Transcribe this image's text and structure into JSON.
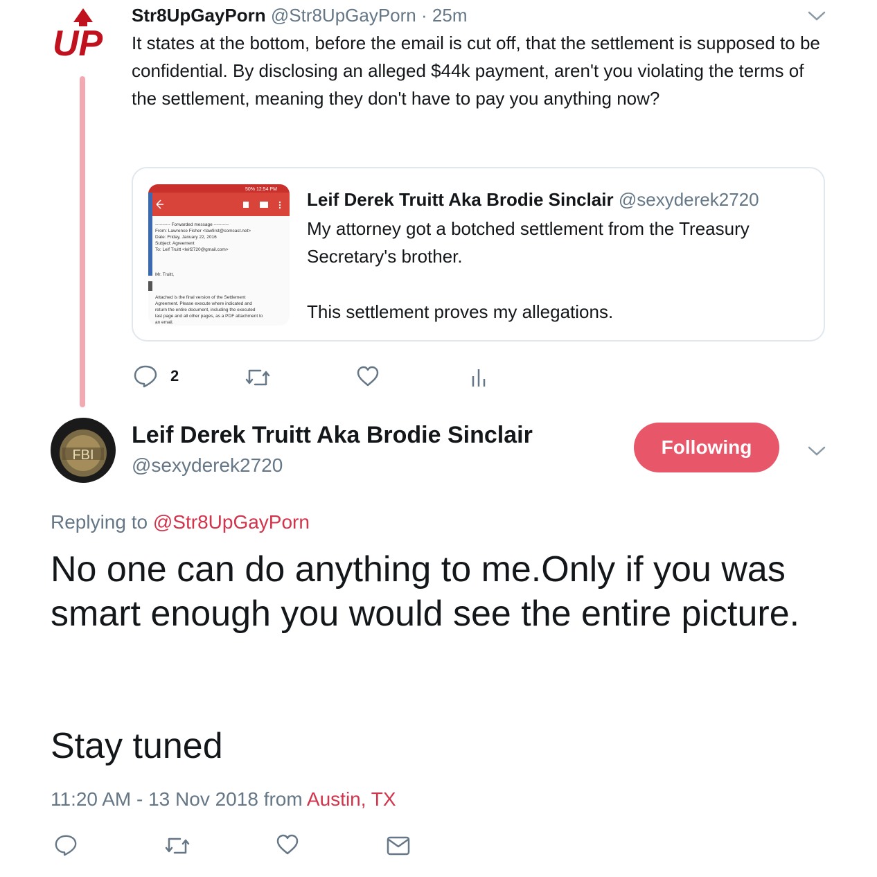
{
  "parent_tweet": {
    "display_name": "Str8UpGayPorn",
    "handle": "@Str8UpGayPorn",
    "separator": "·",
    "time": "25m",
    "text": "It states at the bottom, before the email is cut off, that the settlement is supposed to be confidential. By disclosing an alleged $44k payment, aren't you violating the terms of the settlement, meaning they don't have to pay you anything now?",
    "avatar_logo_text": "UP",
    "quoted": {
      "display_name": "Leif Derek Truitt Aka Brodie Sinclair",
      "handle": "@sexyderek2720",
      "text": "My attorney got a botched settlement from the Treasury Secretary's brother.\n\nThis settlement proves my allegations.",
      "thumbnail": {
        "status_bar": "50% 12:54 PM",
        "lines": [
          "---------- Forwarded message ----------",
          "From: Lawrence Fisher <lawfirst@comcast.net>",
          "Date: Friday, January 22, 2016",
          "Subject: Agreement",
          "To: Leif Truitt <leif2720@gmail.com>",
          "Mr. Truitt,",
          "Attached is the final version of the Settlement",
          "Agreement. Please execute where indicated and",
          "return the entire document, including the executed",
          "last page and all other pages, as a PDF attachment to",
          "an email."
        ]
      }
    },
    "actions": {
      "reply_count": "2"
    }
  },
  "main_tweet": {
    "display_name": "Leif Derek Truitt Aka Brodie Sinclair",
    "handle": "@sexyderek2720",
    "follow_label": "Following",
    "replying_prefix": "Replying to",
    "replying_handle": "@Str8UpGayPorn",
    "text_line1": "No one can do anything to me.Only if you was smart enough you would see the entire picture.",
    "text_line2": "Stay tuned",
    "timestamp": "11:20 AM - 13 Nov 2018",
    "from_label": "from",
    "location": "Austin, TX",
    "avatar_badge_text": "FBI"
  },
  "colors": {
    "accent": "#e8566a",
    "thread_line": "#f3a9b2",
    "muted": "#657786",
    "link": "#d1344b"
  }
}
